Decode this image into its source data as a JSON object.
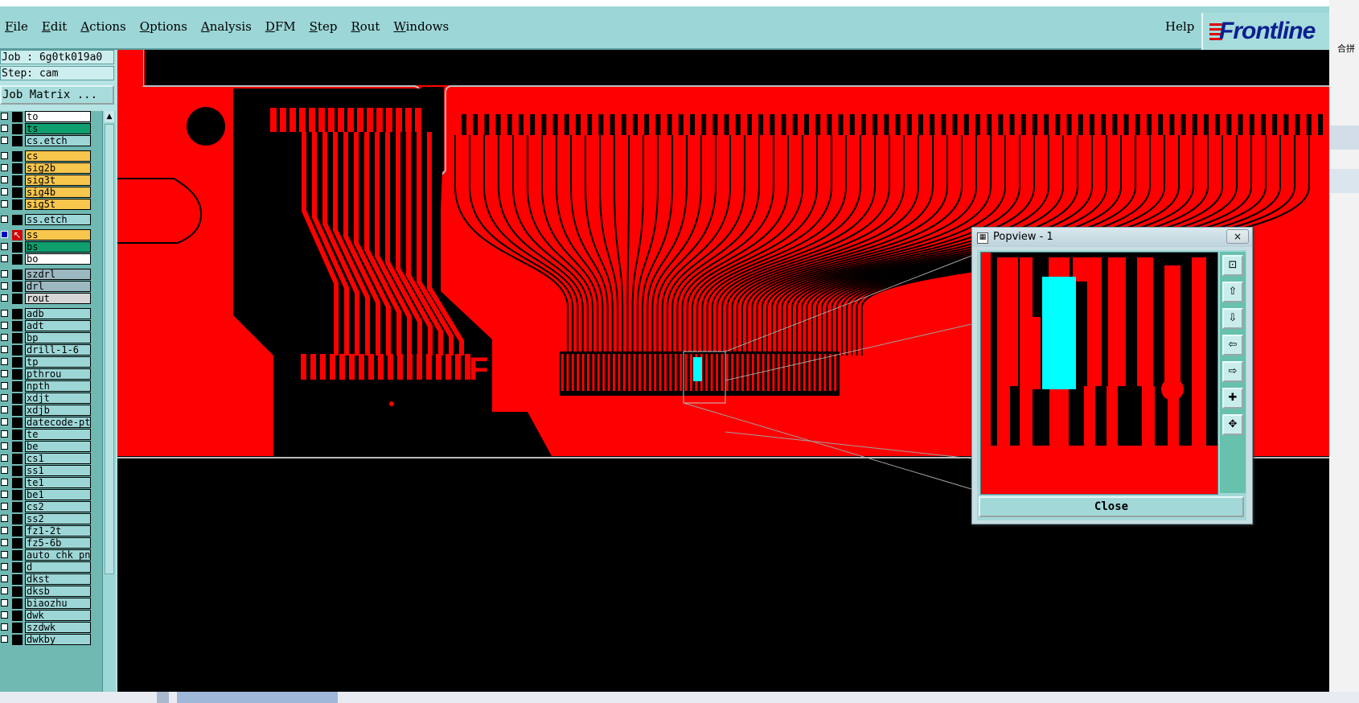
{
  "menubar": {
    "items": [
      "File",
      "Edit",
      "Actions",
      "Options",
      "Analysis",
      "DFM",
      "Step",
      "Rout",
      "Windows"
    ],
    "help": "Help",
    "logo": "Frontline"
  },
  "side_window": {
    "fragment_text": "合拼"
  },
  "left_panel": {
    "job": "Job : 6g0tk019a0",
    "step": "Step: cam",
    "job_matrix": "Job Matrix ..."
  },
  "layers": [
    {
      "name": "to",
      "color": "#ffffff"
    },
    {
      "name": "ts",
      "color": "#0f9e6e"
    },
    {
      "name": "cs.etch",
      "color": "#9dd6d6"
    },
    {
      "name": "cs",
      "color": "#f7c64d"
    },
    {
      "name": "sig2b",
      "color": "#f7c64d"
    },
    {
      "name": "sig3t",
      "color": "#f7c64d"
    },
    {
      "name": "sig4b",
      "color": "#f7c64d"
    },
    {
      "name": "sig5t",
      "color": "#f7c64d"
    },
    {
      "name": "ss.etch",
      "color": "#9dd6d6"
    },
    {
      "name": "ss",
      "color": "#f7c64d",
      "active": true
    },
    {
      "name": "bs",
      "color": "#0f9e6e"
    },
    {
      "name": "bo",
      "color": "#ffffff"
    },
    {
      "name": "szdrl",
      "color": "#9cb8c0"
    },
    {
      "name": "drl",
      "color": "#9cb8c0"
    },
    {
      "name": "rout",
      "color": "#d6d6d6"
    },
    {
      "name": "adb",
      "color": "#9dd6d6"
    },
    {
      "name": "adt",
      "color": "#9dd6d6"
    },
    {
      "name": "bp",
      "color": "#9dd6d6"
    },
    {
      "name": "drill-1-6",
      "color": "#9dd6d6"
    },
    {
      "name": "tp",
      "color": "#9dd6d6"
    },
    {
      "name": "pthrou",
      "color": "#9dd6d6"
    },
    {
      "name": "npth",
      "color": "#9dd6d6"
    },
    {
      "name": "xdjt",
      "color": "#9dd6d6"
    },
    {
      "name": "xdjb",
      "color": "#9dd6d6"
    },
    {
      "name": "datecode-pto",
      "color": "#9dd6d6"
    },
    {
      "name": "te",
      "color": "#9dd6d6"
    },
    {
      "name": "be",
      "color": "#9dd6d6"
    },
    {
      "name": "cs1",
      "color": "#9dd6d6"
    },
    {
      "name": "ss1",
      "color": "#9dd6d6"
    },
    {
      "name": "te1",
      "color": "#9dd6d6"
    },
    {
      "name": "be1",
      "color": "#9dd6d6"
    },
    {
      "name": "cs2",
      "color": "#9dd6d6"
    },
    {
      "name": "ss2",
      "color": "#9dd6d6"
    },
    {
      "name": "fz1-2t",
      "color": "#9dd6d6"
    },
    {
      "name": "fz5-6b",
      "color": "#9dd6d6"
    },
    {
      "name": "auto_chk_pnl",
      "color": "#9dd6d6"
    },
    {
      "name": "d",
      "color": "#9dd6d6"
    },
    {
      "name": "dkst",
      "color": "#9dd6d6"
    },
    {
      "name": "dksb",
      "color": "#9dd6d6"
    },
    {
      "name": "biaozhu",
      "color": "#9dd6d6"
    },
    {
      "name": "dwk",
      "color": "#9dd6d6"
    },
    {
      "name": "szdwk",
      "color": "#9dd6d6"
    },
    {
      "name": "dwkby",
      "color": "#9dd6d6"
    }
  ],
  "popview": {
    "title": "Popview - 1",
    "close_x": "×",
    "close_label": "Close",
    "tools": [
      "zoom-fit-icon",
      "move-up-icon",
      "move-down-icon",
      "move-left-icon",
      "move-right-icon",
      "zoom-in-icon",
      "zoom-out-icon"
    ]
  },
  "colors": {
    "copper": "#ff0000",
    "highlight": "#00ffff",
    "background": "#000000",
    "ui": "#9dd6d6"
  }
}
